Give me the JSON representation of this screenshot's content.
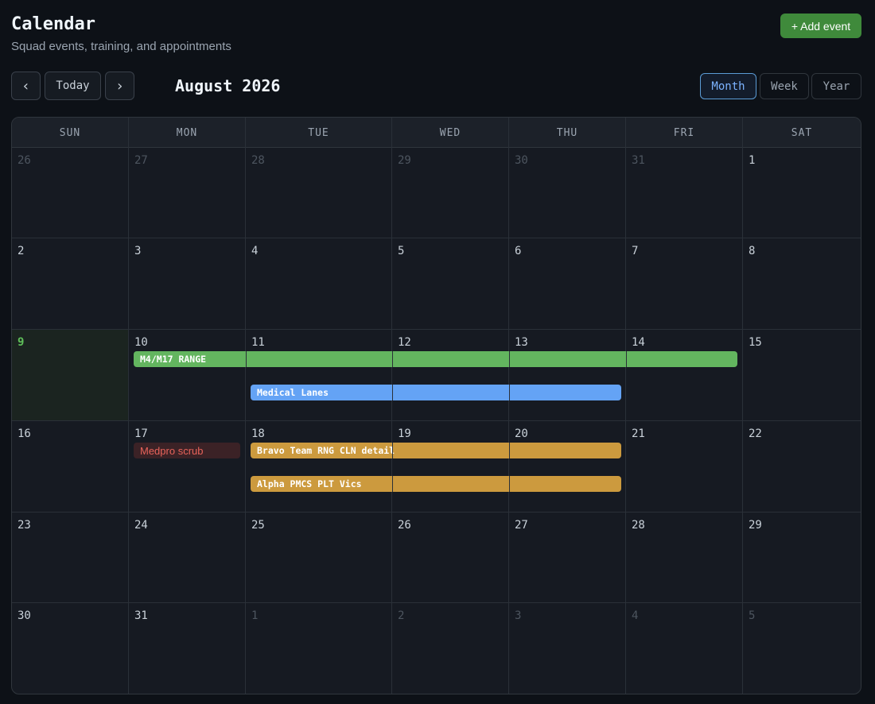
{
  "header": {
    "title": "Calendar",
    "subtitle": "Squad events, training, and appointments",
    "add_label": "+ Add event"
  },
  "nav": {
    "prev": "‹",
    "today": "Today",
    "next": "›",
    "month_label": "August 2026"
  },
  "views": {
    "month": "Month",
    "week": "Week",
    "year": "Year",
    "active": "Month"
  },
  "weekdays": [
    "SUN",
    "MON",
    "TUE",
    "WED",
    "THU",
    "FRI",
    "SAT"
  ],
  "weeks": [
    [
      "26",
      "27",
      "28",
      "29",
      "30",
      "31",
      "1"
    ],
    [
      "2",
      "3",
      "4",
      "5",
      "6",
      "7",
      "8"
    ],
    [
      "9",
      "10",
      "11",
      "12",
      "13",
      "14",
      "15"
    ],
    [
      "16",
      "17",
      "18",
      "19",
      "20",
      "21",
      "22"
    ],
    [
      "23",
      "24",
      "25",
      "26",
      "27",
      "28",
      "29"
    ],
    [
      "30",
      "31",
      "1",
      "2",
      "3",
      "4",
      "5"
    ]
  ],
  "events": [
    {
      "title": "M4/M17 RANGE",
      "color": "#63b55f"
    },
    {
      "title": "Medical Lanes",
      "color": "#64a3f5"
    },
    {
      "title": "Medpro scrub",
      "color": "#e8635a"
    },
    {
      "title": "Bravo Team RNG CLN detail",
      "color": "#cc9a3e"
    },
    {
      "title": "Alpha PMCS PLT Vics",
      "color": "#cc9a3e"
    }
  ],
  "colors": {
    "accent": "#3f8a3b",
    "today": "#5fbf5a",
    "active_view": "#7cb3ff"
  }
}
